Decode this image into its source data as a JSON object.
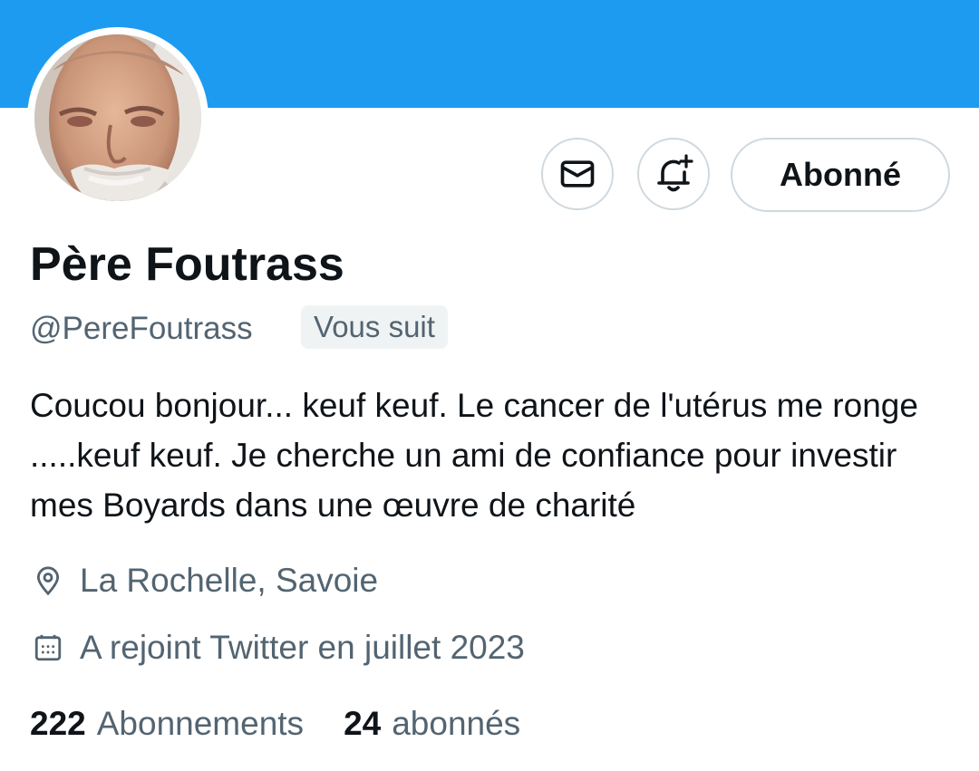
{
  "colors": {
    "banner": "#1d9bf0",
    "text_primary": "#0f1419",
    "text_secondary": "#536471",
    "border": "#cfd9de",
    "badge_bg": "#eff3f4"
  },
  "header": {
    "banner_icon": "banner-image",
    "avatar_icon": "avatar-image"
  },
  "actions": {
    "message_icon": "mail-icon",
    "notify_icon": "bell-plus-icon",
    "follow_label": "Abonné"
  },
  "profile": {
    "display_name": "Père Foutrass",
    "handle": "@PereFoutrass",
    "follows_you": "Vous suit",
    "bio": "Coucou bonjour... keuf keuf. Le cancer de l'utérus me ronge .....keuf keuf. Je cherche un ami de confiance pour investir mes Boyards dans une œuvre de charité",
    "location": "La Rochelle, Savoie",
    "location_icon": "location-pin-icon",
    "joined": "A rejoint Twitter en juillet 2023",
    "joined_icon": "calendar-icon"
  },
  "stats": {
    "following_count": "222",
    "following_label": "Abonnements",
    "followers_count": "24",
    "followers_label": "abonnés"
  }
}
